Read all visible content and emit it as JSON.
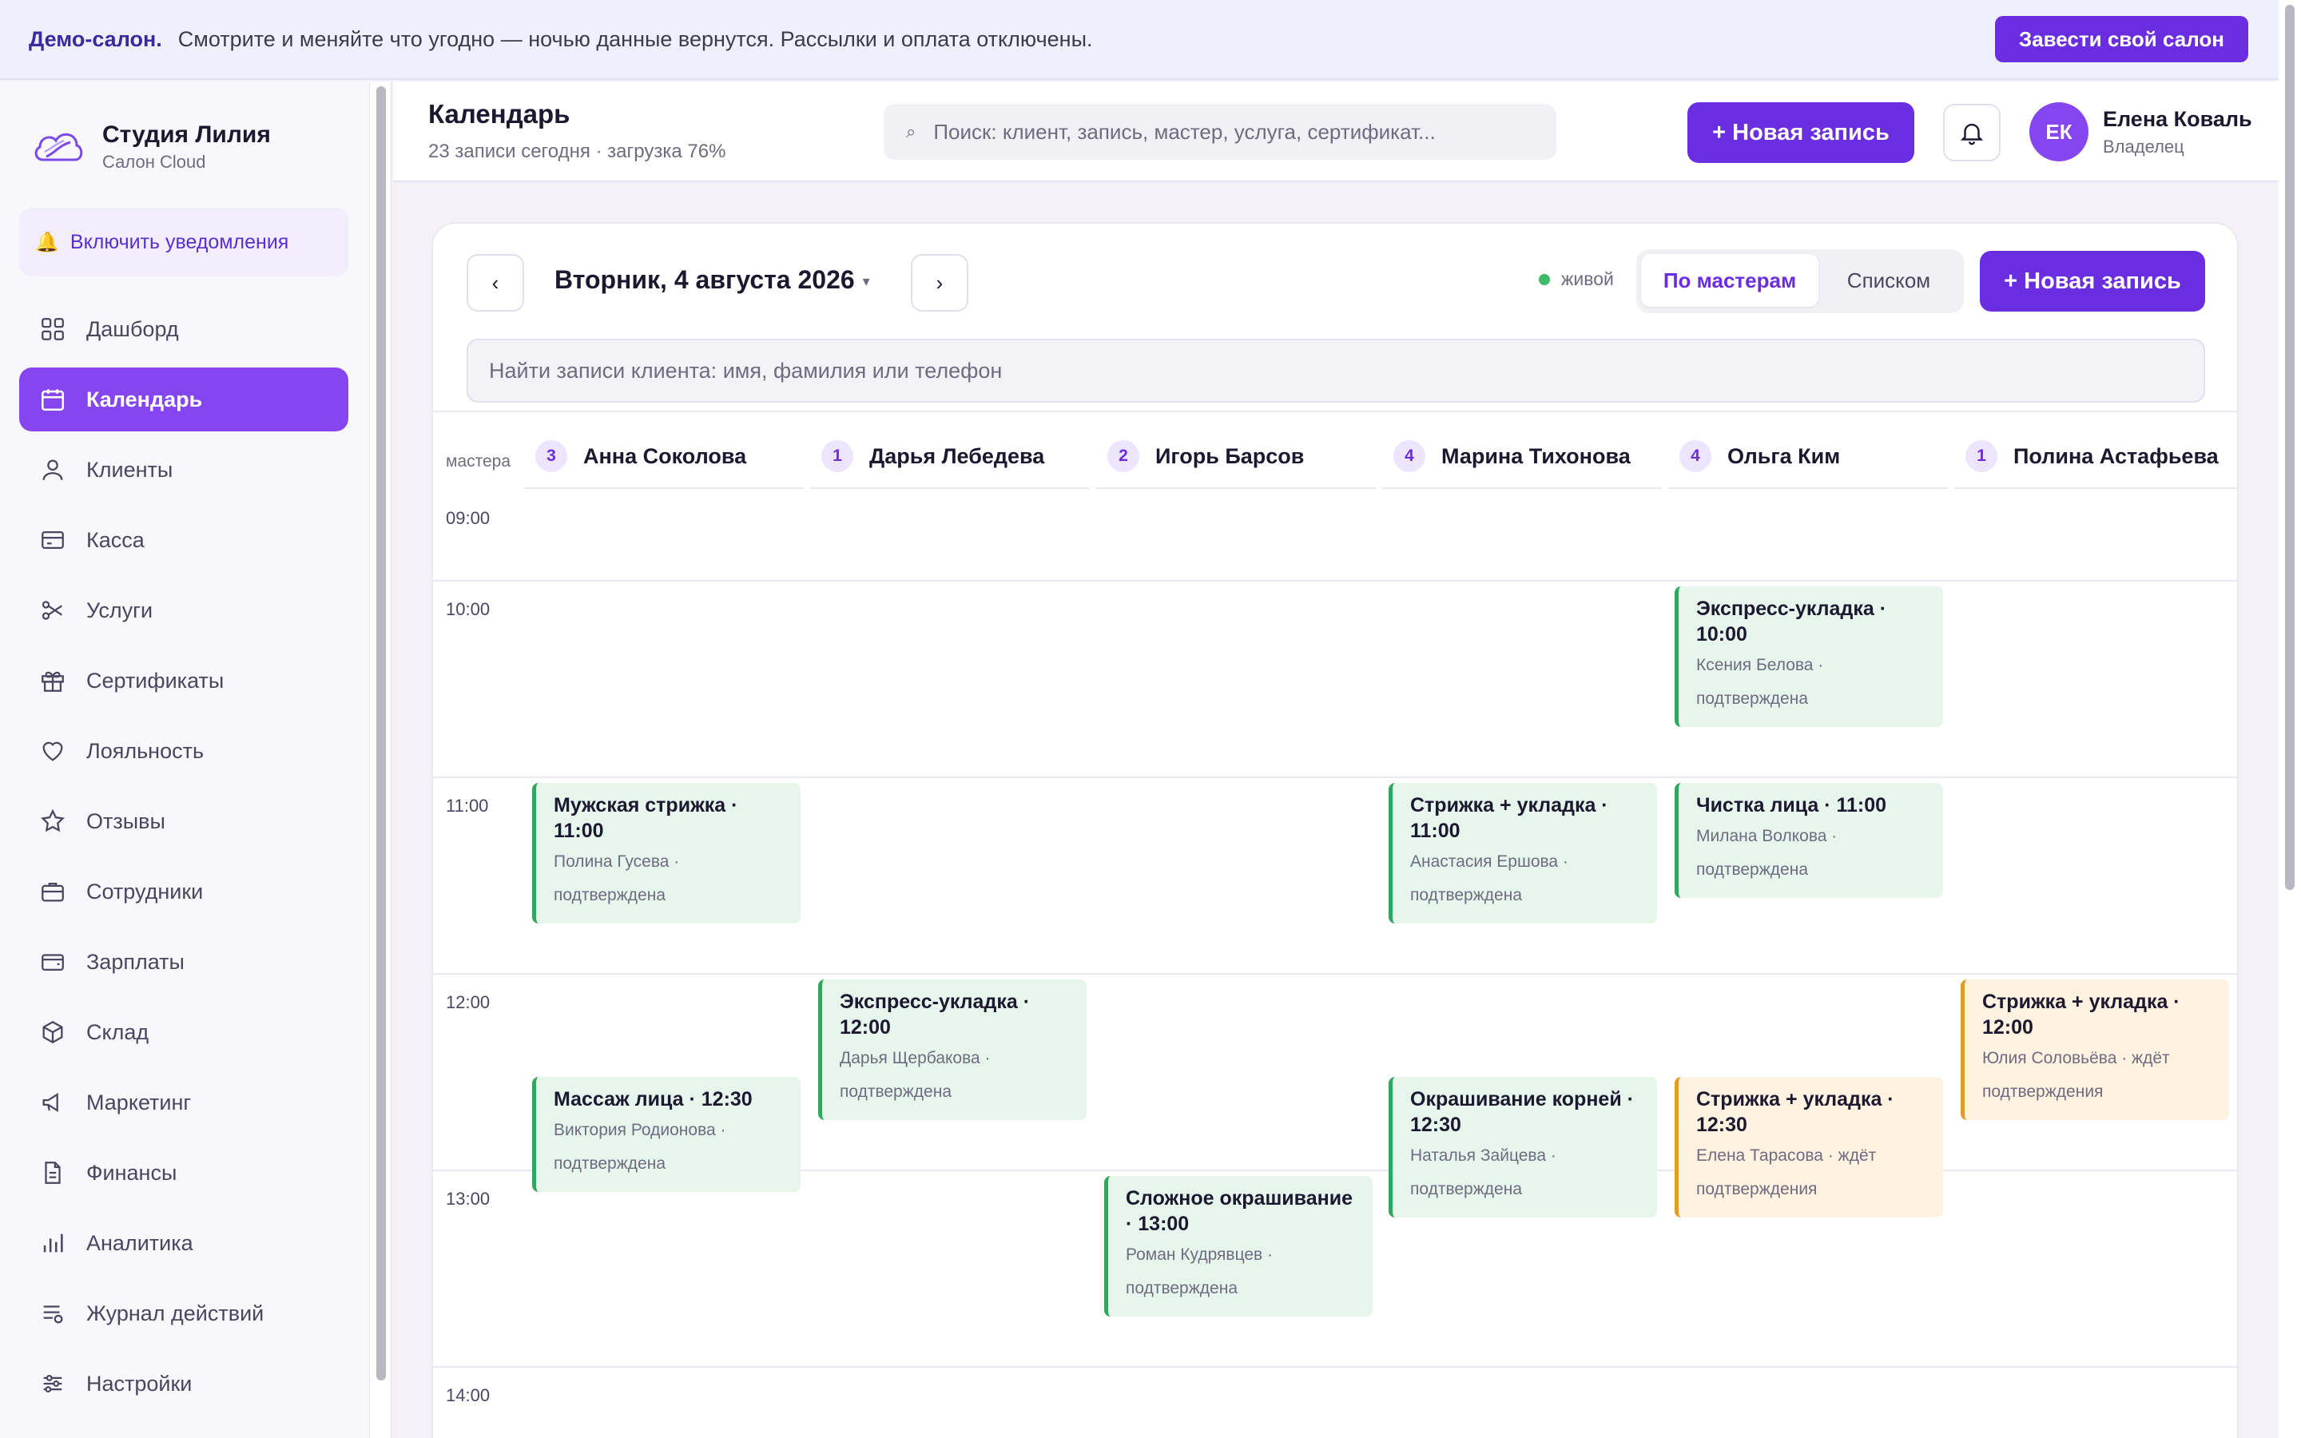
{
  "banner": {
    "bold": "Демо-салон.",
    "text": "Смотрите и меняйте что угодно — ночью данные вернутся. Рассылки и оплата отключены.",
    "button": "Завести свой салон"
  },
  "brand": {
    "name": "Студия Лилия",
    "sub": "Салон Cloud"
  },
  "notifications_button": "Включить уведомления",
  "nav": [
    {
      "label": "Дашборд",
      "icon": "grid-icon",
      "active": false
    },
    {
      "label": "Календарь",
      "icon": "calendar-icon",
      "active": true
    },
    {
      "label": "Клиенты",
      "icon": "user-icon",
      "active": false
    },
    {
      "label": "Касса",
      "icon": "credit-card-icon",
      "active": false
    },
    {
      "label": "Услуги",
      "icon": "scissors-icon",
      "active": false
    },
    {
      "label": "Сертификаты",
      "icon": "gift-icon",
      "active": false
    },
    {
      "label": "Лояльность",
      "icon": "heart-icon",
      "active": false
    },
    {
      "label": "Отзывы",
      "icon": "star-icon",
      "active": false
    },
    {
      "label": "Сотрудники",
      "icon": "briefcase-icon",
      "active": false
    },
    {
      "label": "Зарплаты",
      "icon": "wallet-icon",
      "active": false
    },
    {
      "label": "Склад",
      "icon": "box-icon",
      "active": false
    },
    {
      "label": "Маркетинг",
      "icon": "megaphone-icon",
      "active": false
    },
    {
      "label": "Финансы",
      "icon": "document-icon",
      "active": false
    },
    {
      "label": "Аналитика",
      "icon": "bar-chart-icon",
      "active": false
    },
    {
      "label": "Журнал действий",
      "icon": "list-icon",
      "active": false
    },
    {
      "label": "Настройки",
      "icon": "sliders-icon",
      "active": false
    }
  ],
  "header": {
    "title": "Календарь",
    "subtitle": "23 записи сегодня · загрузка 76%",
    "search_placeholder": "Поиск: клиент, запись, мастер, услуга, сертификат...",
    "new_button": "+ Новая запись",
    "user_initials": "ЕК",
    "user_name": "Елена Коваль",
    "user_role": "Владелец"
  },
  "calendar": {
    "prev": "‹",
    "next": "›",
    "date": "Вторник, 4 августа 2026",
    "live": "живой",
    "view_by_masters": "По мастерам",
    "view_list": "Списком",
    "new_button": "+ Новая запись",
    "search_placeholder": "Найти записи клиента: имя, фамилия или телефон",
    "masters_label": "мастера",
    "masters": [
      {
        "count": "3",
        "name": "Анна Соколова"
      },
      {
        "count": "1",
        "name": "Дарья Лебедева"
      },
      {
        "count": "2",
        "name": "Игорь Барсов"
      },
      {
        "count": "4",
        "name": "Марина Тихонова"
      },
      {
        "count": "4",
        "name": "Ольга Ким"
      },
      {
        "count": "1",
        "name": "Полина Астафьева"
      }
    ],
    "hours": [
      "09:00",
      "10:00",
      "11:00",
      "12:00",
      "13:00",
      "14:00"
    ],
    "appointments": [
      {
        "title": "Экспресс-укладка · 10:00",
        "client": "Ксения Белова ·",
        "status": "подтверждена",
        "pending": false
      },
      {
        "title": "Мужская стрижка · 11:00",
        "client": "Полина Гусева ·",
        "status": "подтверждена",
        "pending": false
      },
      {
        "title": "Стрижка + укладка · 11:00",
        "client": "Анастасия Ершова ·",
        "status": "подтверждена",
        "pending": false
      },
      {
        "title": "Чистка лица · 11:00",
        "client": "Милана Волкова ·",
        "status": "подтверждена",
        "pending": false
      },
      {
        "title": "Экспресс-укладка · 12:00",
        "client": "Дарья Щербакова ·",
        "status": "подтверждена",
        "pending": false
      },
      {
        "title": "Стрижка + укладка · 12:00",
        "client": "Юлия Соловьёва · ждёт",
        "status": "подтверждения",
        "pending": true
      },
      {
        "title": "Массаж лица · 12:30",
        "client": "Виктория Родионова ·",
        "status": "подтверждена",
        "pending": false
      },
      {
        "title": "Окрашивание корней · 12:30",
        "client": "Наталья Зайцева ·",
        "status": "подтверждена",
        "pending": false
      },
      {
        "title": "Стрижка + укладка · 12:30",
        "client": "Елена Тарасова · ждёт",
        "status": "подтверждения",
        "pending": true
      },
      {
        "title": "Сложное окрашивание · 13:00",
        "client": "Роман Кудрявцев ·",
        "status": "подтверждена",
        "pending": false
      }
    ]
  },
  "colors": {
    "accent": "#6a2ee0",
    "nav_active": "#8546f0",
    "confirmed": "#2fa85b",
    "pending": "#e39a2a"
  }
}
